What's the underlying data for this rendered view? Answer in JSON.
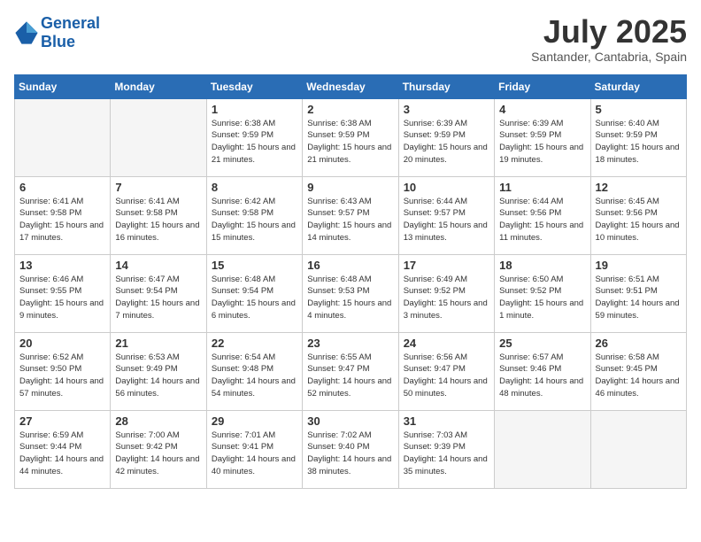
{
  "header": {
    "logo_line1": "General",
    "logo_line2": "Blue",
    "month_year": "July 2025",
    "location": "Santander, Cantabria, Spain"
  },
  "days_of_week": [
    "Sunday",
    "Monday",
    "Tuesday",
    "Wednesday",
    "Thursday",
    "Friday",
    "Saturday"
  ],
  "weeks": [
    [
      {
        "day": "",
        "info": ""
      },
      {
        "day": "",
        "info": ""
      },
      {
        "day": "1",
        "info": "Sunrise: 6:38 AM\nSunset: 9:59 PM\nDaylight: 15 hours and 21 minutes."
      },
      {
        "day": "2",
        "info": "Sunrise: 6:38 AM\nSunset: 9:59 PM\nDaylight: 15 hours and 21 minutes."
      },
      {
        "day": "3",
        "info": "Sunrise: 6:39 AM\nSunset: 9:59 PM\nDaylight: 15 hours and 20 minutes."
      },
      {
        "day": "4",
        "info": "Sunrise: 6:39 AM\nSunset: 9:59 PM\nDaylight: 15 hours and 19 minutes."
      },
      {
        "day": "5",
        "info": "Sunrise: 6:40 AM\nSunset: 9:59 PM\nDaylight: 15 hours and 18 minutes."
      }
    ],
    [
      {
        "day": "6",
        "info": "Sunrise: 6:41 AM\nSunset: 9:58 PM\nDaylight: 15 hours and 17 minutes."
      },
      {
        "day": "7",
        "info": "Sunrise: 6:41 AM\nSunset: 9:58 PM\nDaylight: 15 hours and 16 minutes."
      },
      {
        "day": "8",
        "info": "Sunrise: 6:42 AM\nSunset: 9:58 PM\nDaylight: 15 hours and 15 minutes."
      },
      {
        "day": "9",
        "info": "Sunrise: 6:43 AM\nSunset: 9:57 PM\nDaylight: 15 hours and 14 minutes."
      },
      {
        "day": "10",
        "info": "Sunrise: 6:44 AM\nSunset: 9:57 PM\nDaylight: 15 hours and 13 minutes."
      },
      {
        "day": "11",
        "info": "Sunrise: 6:44 AM\nSunset: 9:56 PM\nDaylight: 15 hours and 11 minutes."
      },
      {
        "day": "12",
        "info": "Sunrise: 6:45 AM\nSunset: 9:56 PM\nDaylight: 15 hours and 10 minutes."
      }
    ],
    [
      {
        "day": "13",
        "info": "Sunrise: 6:46 AM\nSunset: 9:55 PM\nDaylight: 15 hours and 9 minutes."
      },
      {
        "day": "14",
        "info": "Sunrise: 6:47 AM\nSunset: 9:54 PM\nDaylight: 15 hours and 7 minutes."
      },
      {
        "day": "15",
        "info": "Sunrise: 6:48 AM\nSunset: 9:54 PM\nDaylight: 15 hours and 6 minutes."
      },
      {
        "day": "16",
        "info": "Sunrise: 6:48 AM\nSunset: 9:53 PM\nDaylight: 15 hours and 4 minutes."
      },
      {
        "day": "17",
        "info": "Sunrise: 6:49 AM\nSunset: 9:52 PM\nDaylight: 15 hours and 3 minutes."
      },
      {
        "day": "18",
        "info": "Sunrise: 6:50 AM\nSunset: 9:52 PM\nDaylight: 15 hours and 1 minute."
      },
      {
        "day": "19",
        "info": "Sunrise: 6:51 AM\nSunset: 9:51 PM\nDaylight: 14 hours and 59 minutes."
      }
    ],
    [
      {
        "day": "20",
        "info": "Sunrise: 6:52 AM\nSunset: 9:50 PM\nDaylight: 14 hours and 57 minutes."
      },
      {
        "day": "21",
        "info": "Sunrise: 6:53 AM\nSunset: 9:49 PM\nDaylight: 14 hours and 56 minutes."
      },
      {
        "day": "22",
        "info": "Sunrise: 6:54 AM\nSunset: 9:48 PM\nDaylight: 14 hours and 54 minutes."
      },
      {
        "day": "23",
        "info": "Sunrise: 6:55 AM\nSunset: 9:47 PM\nDaylight: 14 hours and 52 minutes."
      },
      {
        "day": "24",
        "info": "Sunrise: 6:56 AM\nSunset: 9:47 PM\nDaylight: 14 hours and 50 minutes."
      },
      {
        "day": "25",
        "info": "Sunrise: 6:57 AM\nSunset: 9:46 PM\nDaylight: 14 hours and 48 minutes."
      },
      {
        "day": "26",
        "info": "Sunrise: 6:58 AM\nSunset: 9:45 PM\nDaylight: 14 hours and 46 minutes."
      }
    ],
    [
      {
        "day": "27",
        "info": "Sunrise: 6:59 AM\nSunset: 9:44 PM\nDaylight: 14 hours and 44 minutes."
      },
      {
        "day": "28",
        "info": "Sunrise: 7:00 AM\nSunset: 9:42 PM\nDaylight: 14 hours and 42 minutes."
      },
      {
        "day": "29",
        "info": "Sunrise: 7:01 AM\nSunset: 9:41 PM\nDaylight: 14 hours and 40 minutes."
      },
      {
        "day": "30",
        "info": "Sunrise: 7:02 AM\nSunset: 9:40 PM\nDaylight: 14 hours and 38 minutes."
      },
      {
        "day": "31",
        "info": "Sunrise: 7:03 AM\nSunset: 9:39 PM\nDaylight: 14 hours and 35 minutes."
      },
      {
        "day": "",
        "info": ""
      },
      {
        "day": "",
        "info": ""
      }
    ]
  ]
}
